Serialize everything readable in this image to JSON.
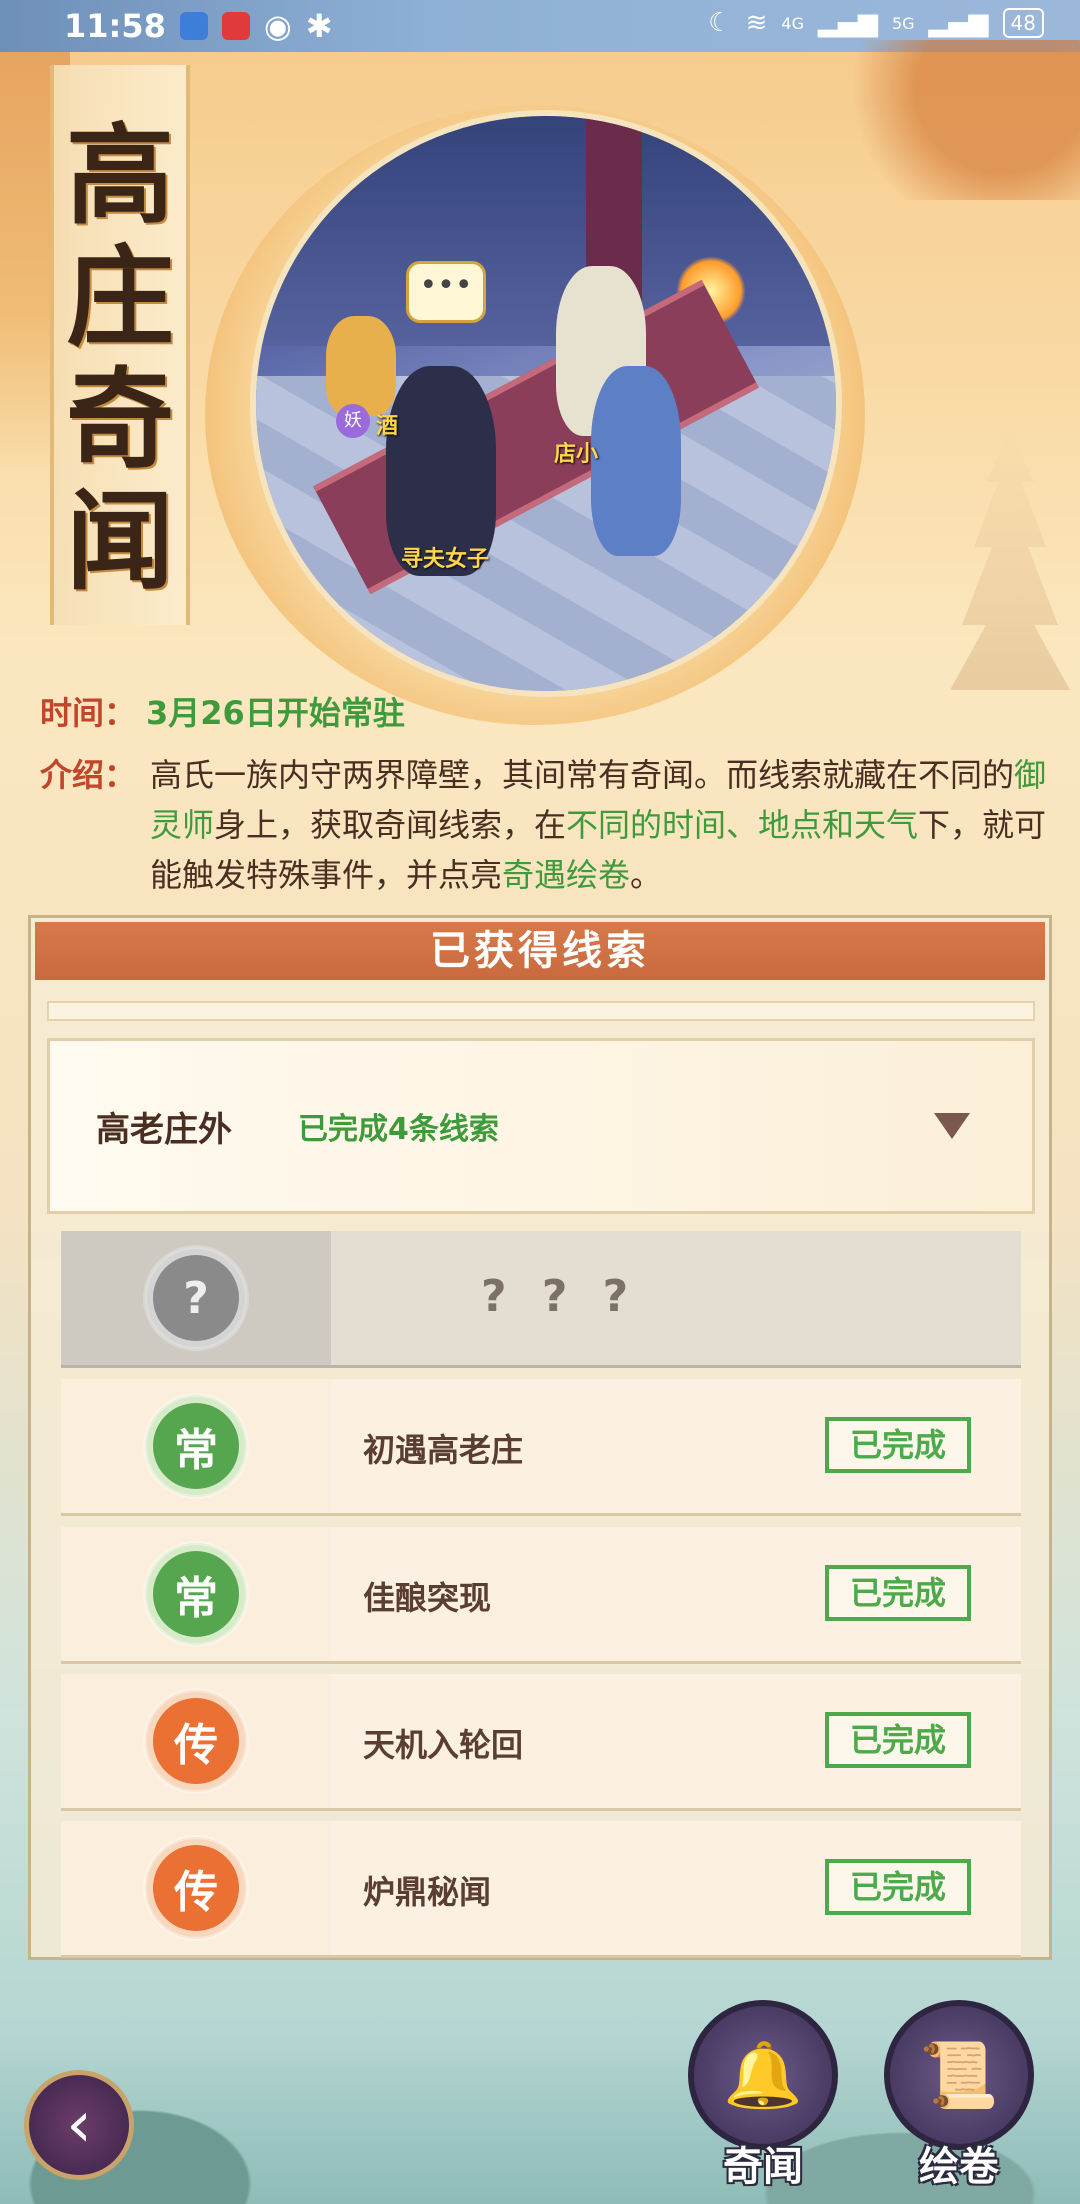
{
  "status_bar": {
    "time": "11:58",
    "network_1": "4G",
    "network_2": "5G",
    "battery": "48"
  },
  "title": [
    "高",
    "庄",
    "奇",
    "闻"
  ],
  "portrait": {
    "bubble": "•••",
    "npc_labels": [
      "酒",
      "店小",
      "寻夫女子"
    ],
    "badge": "妖"
  },
  "info": {
    "time_label": "时间：",
    "time_value": "3月26日开始常驻",
    "intro_label": "介绍：",
    "intro_parts": [
      "高氏一族内守两界障壁，其间常有奇闻。而线索就藏在不同的",
      "御灵师",
      "身上，获取奇闻线索，在",
      "不同的时间、地点和天气",
      "下，就可能触发特殊事件，并点亮",
      "奇遇绘卷",
      "。"
    ]
  },
  "panel": {
    "header": "已获得线索",
    "location": {
      "name": "高老庄外",
      "status": "已完成4条线索"
    },
    "clues": [
      {
        "badge": "?",
        "name": "? ? ?",
        "type": "unknown",
        "status": ""
      },
      {
        "badge": "常",
        "name": "初遇高老庄",
        "type": "chang",
        "status": "已完成"
      },
      {
        "badge": "常",
        "name": "佳酿突现",
        "type": "chang",
        "status": "已完成"
      },
      {
        "badge": "传",
        "name": "天机入轮回",
        "type": "chuan",
        "status": "已完成"
      },
      {
        "badge": "传",
        "name": "炉鼎秘闻",
        "type": "chuan",
        "status": "已完成"
      }
    ]
  },
  "bottom": {
    "back_icon": "back-arrow-icon",
    "qiwen_label": "奇闻",
    "huijuan_label": "绘卷"
  },
  "colors": {
    "accent_green": "#3f9a3c",
    "label_red": "#c0452a",
    "header_orange": "#c86a3e"
  }
}
